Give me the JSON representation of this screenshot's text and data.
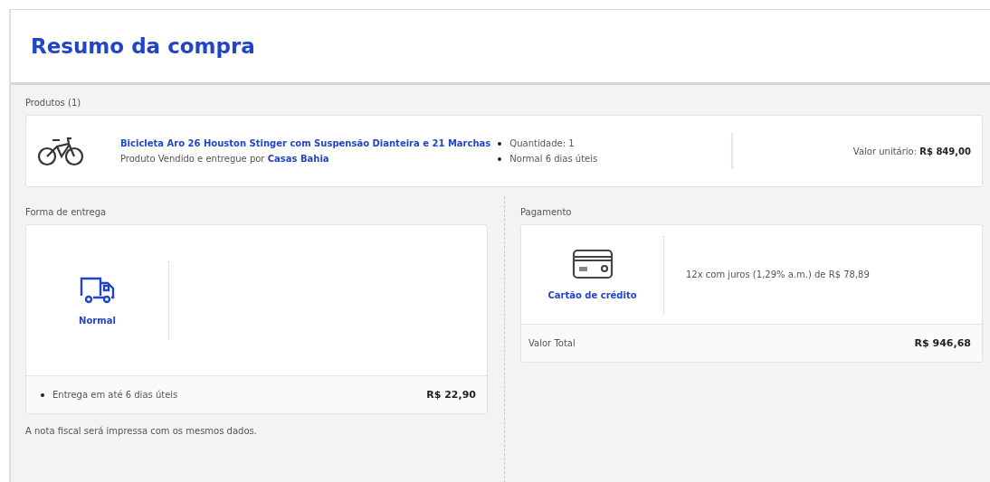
{
  "header": {
    "title": "Resumo da compra"
  },
  "products": {
    "label": "Produtos (1)",
    "items": [
      {
        "name": "Bicicleta Aro 26 Houston Stinger com Suspensão Dianteira e 21 Marchas",
        "seller_prefix": "Produto Vendido e entregue por",
        "seller": "Casas Bahia",
        "details": [
          "Quantidade: 1",
          "Normal 6 dias úteis"
        ],
        "unit_price": "Valor unitário: **R$ 849,00**"
      }
    ]
  },
  "delivery": {
    "label": "Forma de entrega",
    "option": "Normal",
    "summary": "Entrega em até 6 dias úteis",
    "price": "R$ 22,90",
    "note": "A nota fiscal será impressa com os mesmos dados."
  },
  "payment": {
    "label": "Pagamento",
    "method": "Cartão de crédito",
    "installments": "12x com juros (1,29% a.m.) de R$ 78,89",
    "total_label": "Valor Total",
    "total": "R$ 946,68"
  }
}
